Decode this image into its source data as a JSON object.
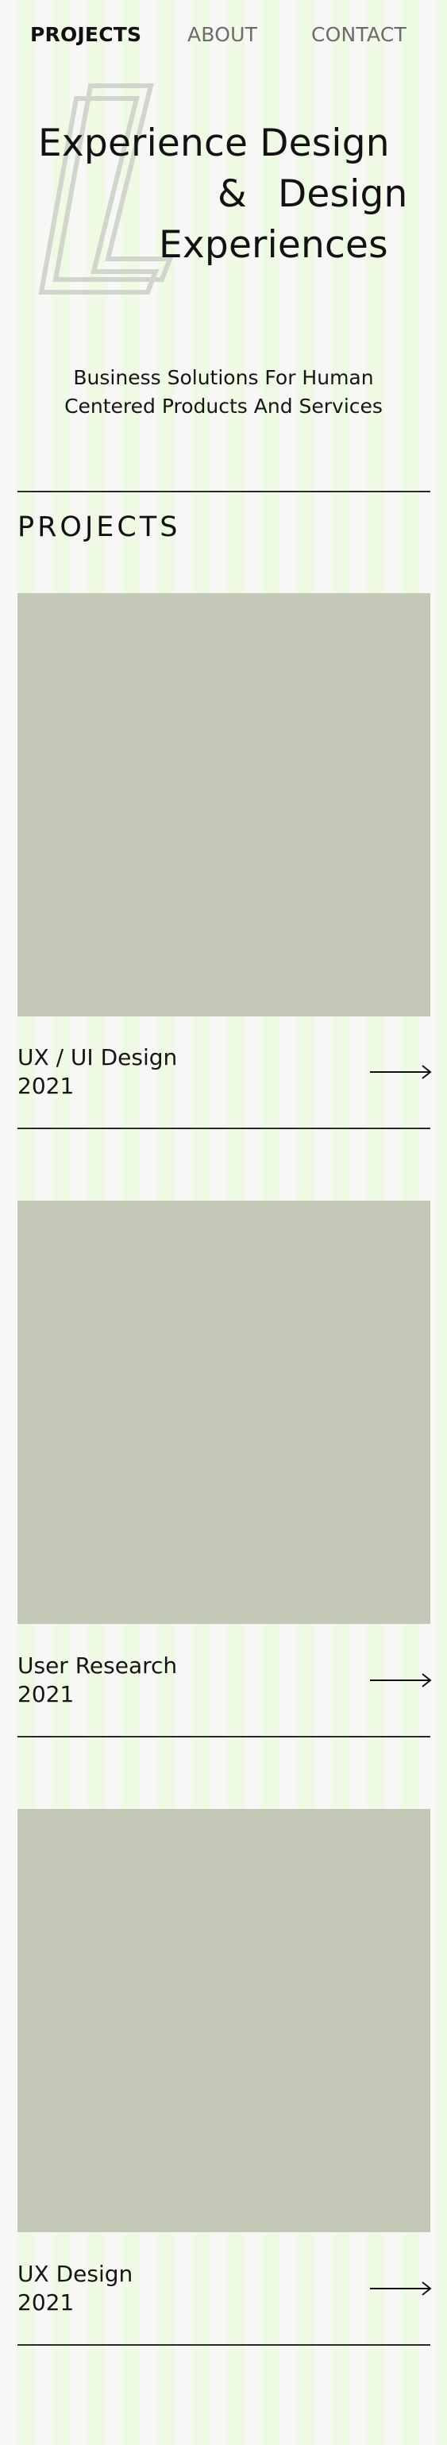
{
  "nav": {
    "items": [
      {
        "label": "PROJECTS",
        "active": true
      },
      {
        "label": "ABOUT",
        "active": false
      },
      {
        "label": "CONTACT",
        "active": false
      }
    ]
  },
  "hero": {
    "line1": "Experience Design",
    "amp": "&",
    "line2": "Design",
    "line3": "Experiences",
    "tagline_line1": "Business Solutions For Human",
    "tagline_line2": "Centered Products And Services"
  },
  "projects": {
    "title": "PROJECTS",
    "items": [
      {
        "name": "UX / UI Design",
        "year": "2021"
      },
      {
        "name": "User Research",
        "year": "2021"
      },
      {
        "name": "UX Design",
        "year": "2021"
      }
    ]
  },
  "colors": {
    "stripe_light": "#f7f8f5",
    "stripe_green": "#eefae3",
    "placeholder": "#c3c7b5",
    "text": "#111111",
    "nav_inactive": "#6b6b6b"
  },
  "icons": {
    "logo": "logo-l-outline",
    "arrow": "arrow-right-icon"
  }
}
